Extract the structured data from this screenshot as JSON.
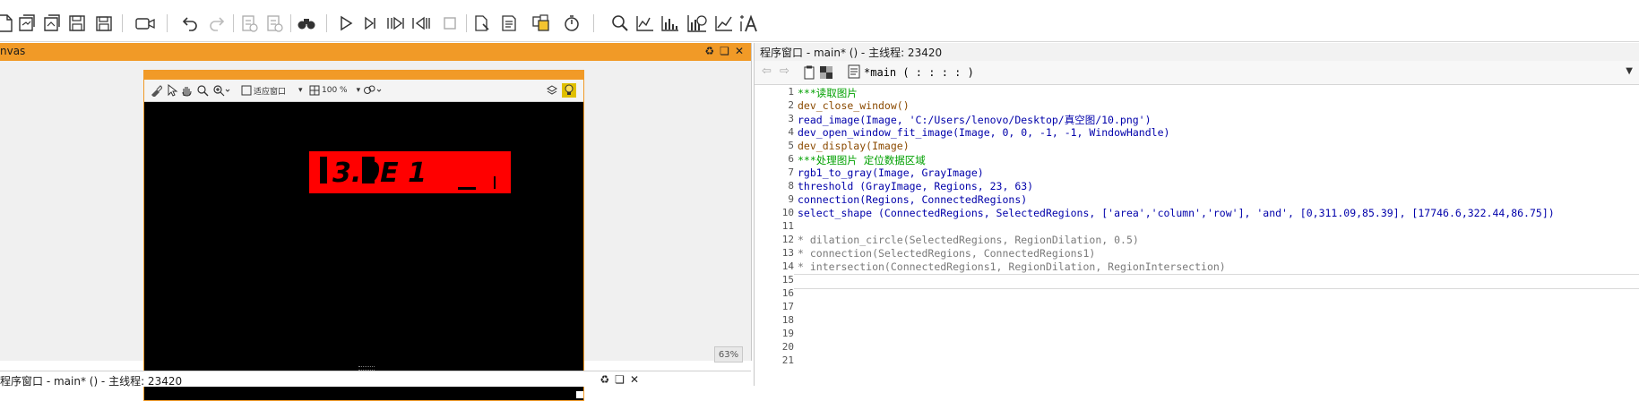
{
  "toolbar": {
    "icons": [
      "new-file-icon",
      "open-icon",
      "open-example-icon",
      "save-icon",
      "save-all-icon",
      "record-icon",
      "undo-icon",
      "redo-icon",
      "checklist-icon",
      "checklist-2-icon",
      "find-icon",
      "run-icon",
      "step-over-icon",
      "step-into-icon",
      "step-out-icon",
      "stop-icon",
      "graphics-icon",
      "variable-icon",
      "operator-icon",
      "profiler-icon",
      "zoom-icon",
      "line-profile-icon",
      "histogram-icon",
      "feature-histogram-icon",
      "gray-profile-icon",
      "ocr-icon"
    ]
  },
  "graphics_window": {
    "title": "nvas",
    "zoom_combo": "适应窗口",
    "percent": "100 %",
    "zoom_badge": "63%",
    "display_text": "3.0E  1"
  },
  "program_window": {
    "title": "程序窗口 - main* () - 主线程: 23420",
    "procedure": "*main ( : : : : )"
  },
  "bottom_window": {
    "title": "程序窗口 - main* () - 主线程: 23420"
  },
  "code": [
    {
      "n": "1",
      "text": "***读取图片",
      "cls": "green"
    },
    {
      "n": "2",
      "text": "dev_close_window()",
      "cls": "brown"
    },
    {
      "n": "3",
      "text": "read_image(Image, 'C:/Users/lenovo/Desktop/真空图/10.png')",
      "cls": "blue"
    },
    {
      "n": "4",
      "text": "dev_open_window_fit_image(Image, 0, 0, -1, -1, WindowHandle)",
      "cls": "blue"
    },
    {
      "n": "5",
      "text": "dev_display(Image)",
      "cls": "brown"
    },
    {
      "n": "6",
      "text": "***处理图片 定位数据区域",
      "cls": "green"
    },
    {
      "n": "7",
      "text": "rgb1_to_gray(Image, GrayImage)",
      "cls": "blue"
    },
    {
      "n": "8",
      "text": "threshold (GrayImage, Regions, 23, 63)",
      "cls": "blue"
    },
    {
      "n": "9",
      "text": "connection(Regions, ConnectedRegions)",
      "cls": "blue"
    },
    {
      "n": "10",
      "text": "select_shape (ConnectedRegions, SelectedRegions, ['area','column','row'], 'and', [0,311.09,85.39], [17746.6,322.44,86.75])",
      "cls": "blue"
    },
    {
      "n": "11",
      "text": "",
      "cls": "blue"
    },
    {
      "n": "12",
      "text": "* dilation_circle(SelectedRegions, RegionDilation, 0.5)",
      "cls": "gray"
    },
    {
      "n": "13",
      "text": "* connection(SelectedRegions, ConnectedRegions1)",
      "cls": "gray"
    },
    {
      "n": "14",
      "text": "* intersection(ConnectedRegions1, RegionDilation, RegionIntersection)",
      "cls": "gray"
    },
    {
      "n": "15",
      "text": "",
      "cls": "gray"
    },
    {
      "n": "16",
      "text": "",
      "cls": "gray"
    },
    {
      "n": "17",
      "text": "",
      "cls": "gray"
    },
    {
      "n": "18",
      "text": "",
      "cls": "gray"
    },
    {
      "n": "19",
      "text": "",
      "cls": "gray"
    },
    {
      "n": "20",
      "text": "",
      "cls": "gray"
    },
    {
      "n": "21",
      "text": "",
      "cls": "gray"
    }
  ]
}
